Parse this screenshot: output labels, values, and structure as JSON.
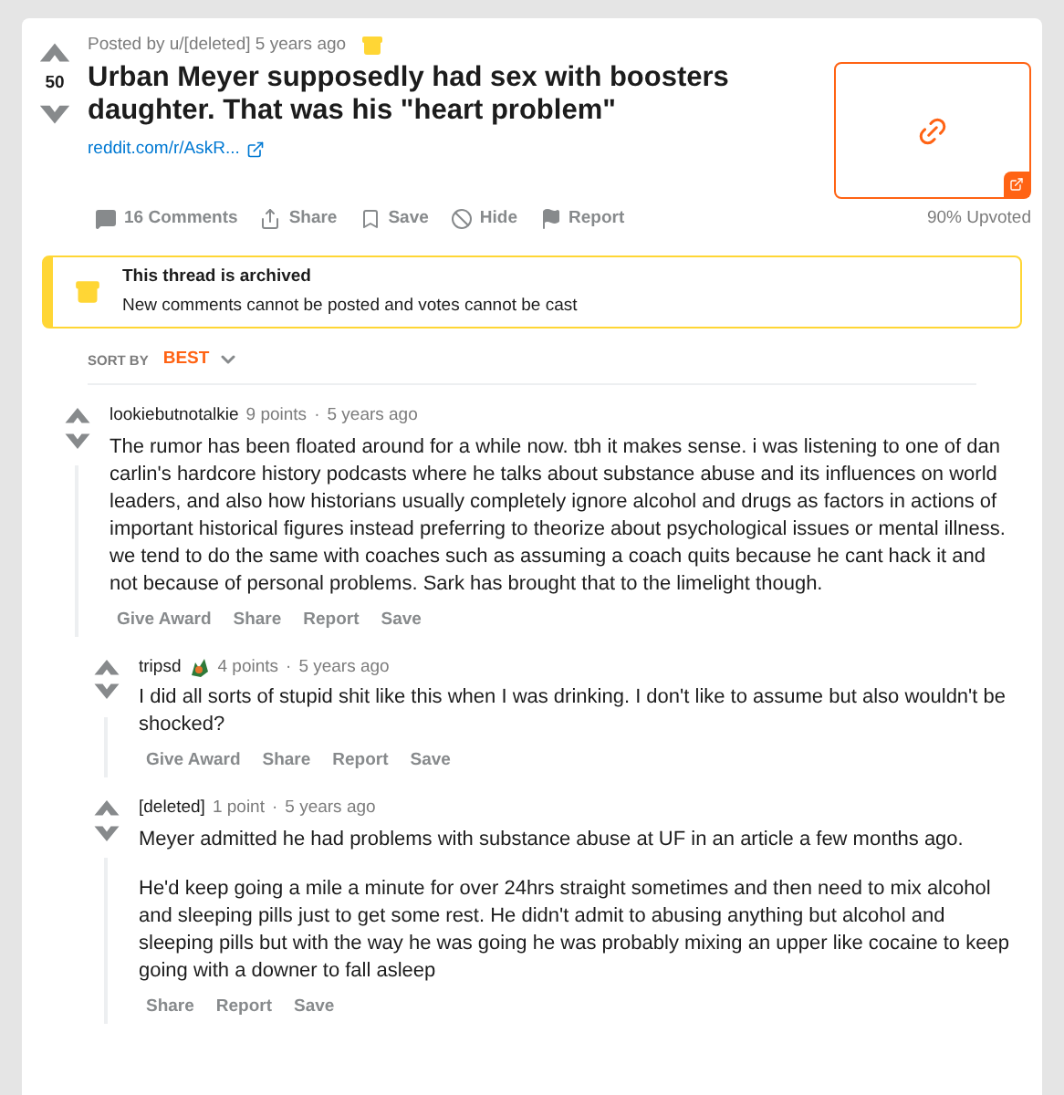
{
  "post": {
    "posted_by": "Posted by u/[deleted] 5 years ago",
    "score": "50",
    "title": "Urban Meyer supposedly had sex with boosters daughter. That was his \"heart problem\"",
    "link": "reddit.com/r/AskR...",
    "actions": [
      {
        "kind": "comments",
        "label": "16 Comments"
      },
      {
        "kind": "share",
        "label": "Share"
      },
      {
        "kind": "save",
        "label": "Save"
      },
      {
        "kind": "hide",
        "label": "Hide"
      },
      {
        "kind": "report",
        "label": "Report"
      }
    ],
    "upvoted": "90% Upvoted"
  },
  "archived_notice": {
    "title": "This thread is archived",
    "message": "New comments cannot be posted and votes cannot be cast"
  },
  "sort": {
    "label": "SORT BY",
    "value": "BEST"
  },
  "comments": [
    {
      "author": "lookiebutnotalkie",
      "has_flair": false,
      "points": "9 points",
      "separator": "·",
      "time": "5 years ago",
      "paragraphs": [
        "The rumor has been floated around for a while now. tbh it makes sense. i was listening to one of dan carlin's hardcore history podcasts where he talks about substance abuse and its influences on world leaders, and also how historians usually completely ignore alcohol and drugs as factors in actions of important historical figures instead preferring to theorize about psychological issues or mental illness. we tend to do the same with coaches such as assuming a coach quits because he cant hack it and not because of personal problems. Sark has brought that to the limelight though."
      ],
      "actions": [
        "Give Award",
        "Share",
        "Report",
        "Save"
      ],
      "children": [
        {
          "author": "tripsd",
          "has_flair": true,
          "points": "4 points",
          "separator": "·",
          "time": "5 years ago",
          "paragraphs": [
            "I did all sorts of stupid shit like this when I was drinking. I don't like to assume but also wouldn't be shocked?"
          ],
          "actions": [
            "Give Award",
            "Share",
            "Report",
            "Save"
          ]
        },
        {
          "author": "[deleted]",
          "has_flair": false,
          "points": "1 point",
          "separator": "·",
          "time": "5 years ago",
          "paragraphs": [
            "Meyer admitted he had problems with substance abuse at UF in an article a few months ago.",
            "He'd keep going a mile a minute for over 24hrs straight sometimes and then need to mix alcohol and sleeping pills just to get some rest. He didn't admit to abusing anything but alcohol and sleeping pills but with the way he was going he was probably mixing an upper like cocaine to keep going with a downer to fall asleep"
          ],
          "actions": [
            "Share",
            "Report",
            "Save"
          ]
        }
      ]
    }
  ]
}
